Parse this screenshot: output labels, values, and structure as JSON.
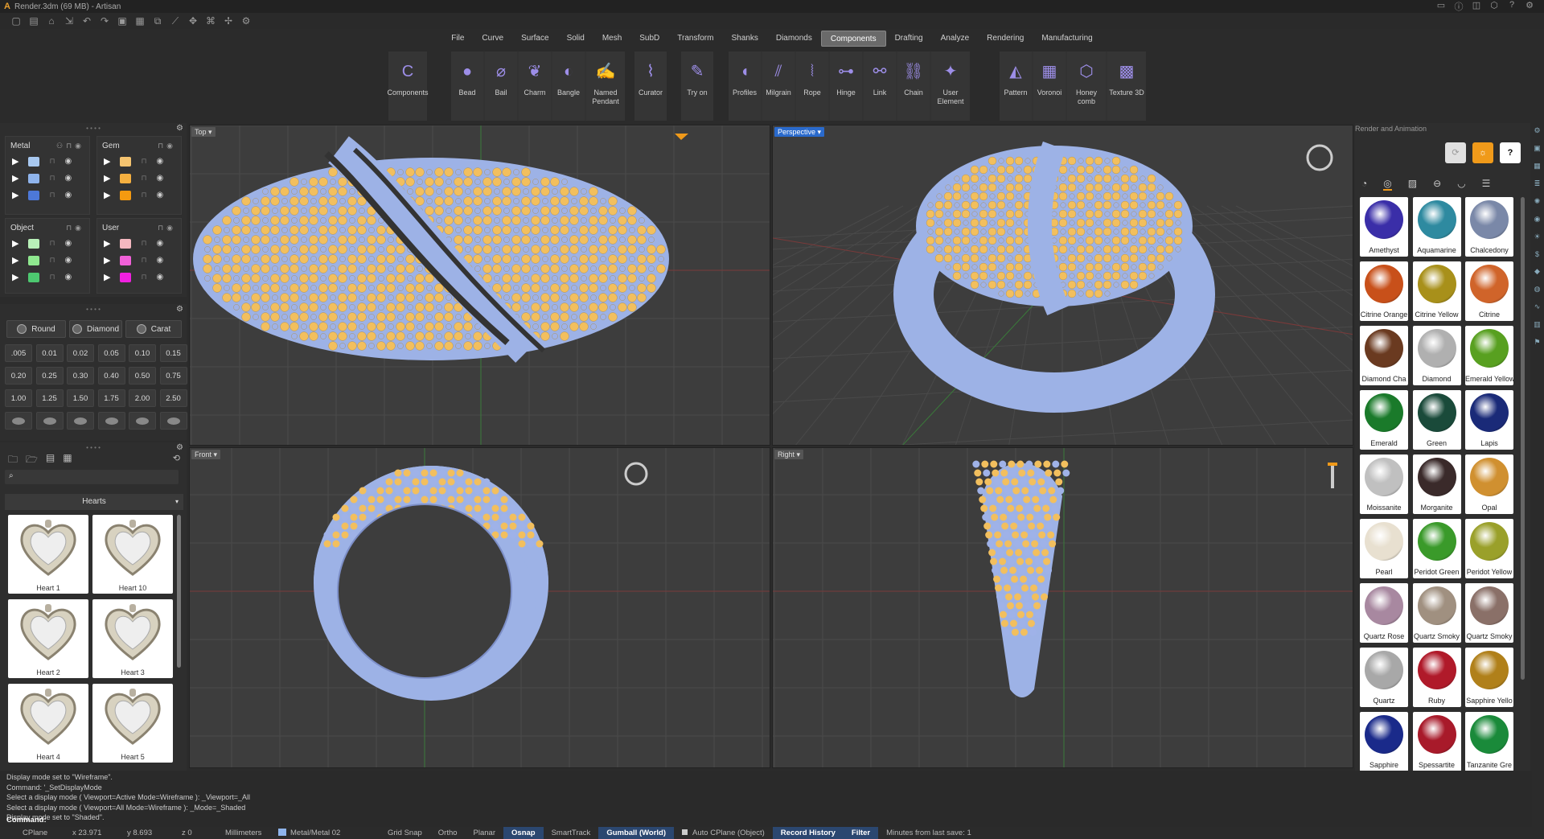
{
  "window": {
    "title": "Render.3dm (69 MB) - Artisan"
  },
  "menu": [
    {
      "label": "File"
    },
    {
      "label": "Curve"
    },
    {
      "label": "Surface"
    },
    {
      "label": "Solid"
    },
    {
      "label": "Mesh"
    },
    {
      "label": "SubD"
    },
    {
      "label": "Transform"
    },
    {
      "label": "Shanks"
    },
    {
      "label": "Diamonds"
    },
    {
      "label": "Components",
      "active": true
    },
    {
      "label": "Drafting"
    },
    {
      "label": "Analyze"
    },
    {
      "label": "Rendering"
    },
    {
      "label": "Manufacturing"
    }
  ],
  "ribbon": {
    "g1": [
      {
        "label": "Components",
        "icon": "C"
      }
    ],
    "g2": [
      {
        "label": "Bead",
        "icon": "●"
      },
      {
        "label": "Bail",
        "icon": "⌀"
      },
      {
        "label": "Charm",
        "icon": "❦"
      },
      {
        "label": "Bangle",
        "icon": "◐"
      },
      {
        "label": "Named Pendant",
        "icon": "✍"
      }
    ],
    "g3": [
      {
        "label": "Curator",
        "icon": "⌇"
      }
    ],
    "g4": [
      {
        "label": "Try on",
        "icon": "✎"
      }
    ],
    "g5": [
      {
        "label": "Profiles",
        "icon": "◖"
      },
      {
        "label": "Milgrain",
        "icon": "⫽"
      },
      {
        "label": "Rope",
        "icon": "⦚"
      },
      {
        "label": "Hinge",
        "icon": "⊶"
      },
      {
        "label": "Link",
        "icon": "⚯"
      },
      {
        "label": "Chain",
        "icon": "⛓"
      },
      {
        "label": "User Element",
        "icon": "✦"
      }
    ],
    "g6": [
      {
        "label": "Pattern",
        "icon": "◭"
      },
      {
        "label": "Voronoi",
        "icon": "▦"
      },
      {
        "label": "Honey comb",
        "icon": "⬡"
      },
      {
        "label": "Texture 3D",
        "icon": "▩"
      }
    ]
  },
  "layers": {
    "metal": {
      "title": "Metal",
      "colors": [
        "#a8c8f0",
        "#8fb4ec",
        "#4d78d8"
      ]
    },
    "gem": {
      "title": "Gem",
      "colors": [
        "#f5c470",
        "#f5b040",
        "#f59a10"
      ]
    },
    "object": {
      "title": "Object",
      "colors": [
        "#b8f0b8",
        "#8fe88f",
        "#4dc870"
      ]
    },
    "user": {
      "title": "User",
      "colors": [
        "#f5b8c0",
        "#f060d8",
        "#f020e0"
      ]
    }
  },
  "gems": {
    "types": [
      {
        "label": "Round"
      },
      {
        "label": "Diamond"
      },
      {
        "label": "Carat"
      }
    ],
    "sizes": [
      ".005",
      "0.01",
      "0.02",
      "0.05",
      "0.10",
      "0.15",
      "0.20",
      "0.25",
      "0.30",
      "0.40",
      "0.50",
      "0.75",
      "1.00",
      "1.25",
      "1.50",
      "1.75",
      "2.00",
      "2.50"
    ]
  },
  "library": {
    "category": "Hearts",
    "items": [
      {
        "label": "Heart 1"
      },
      {
        "label": "Heart 10"
      },
      {
        "label": "Heart 2"
      },
      {
        "label": "Heart 3"
      },
      {
        "label": "Heart 4"
      },
      {
        "label": "Heart 5"
      }
    ]
  },
  "viewports": {
    "top": "Top",
    "perspective": "Perspective",
    "front": "Front",
    "right": "Right"
  },
  "render_panel": {
    "title": "Render and Animation",
    "materials": [
      {
        "label": "Amethyst",
        "color": "#3a2ea8"
      },
      {
        "label": "Aquamarine",
        "color": "#2e8aa0"
      },
      {
        "label": "Chalcedony",
        "color": "#7a88a8"
      },
      {
        "label": "Citrine Orange",
        "color": "#c8501a"
      },
      {
        "label": "Citrine Yellow",
        "color": "#a8901a"
      },
      {
        "label": "Citrine",
        "color": "#d0642a"
      },
      {
        "label": "Diamond Cha",
        "color": "#6a3a20"
      },
      {
        "label": "Diamond",
        "color": "#b0b0b0"
      },
      {
        "label": "Emerald Yellow",
        "color": "#58a020"
      },
      {
        "label": "Emerald",
        "color": "#1a7a2a"
      },
      {
        "label": "Green",
        "color": "#1a4a3a"
      },
      {
        "label": "Lapis",
        "color": "#1a2a78"
      },
      {
        "label": "Moissanite",
        "color": "#c0c0c0"
      },
      {
        "label": "Morganite",
        "color": "#3a2a2a"
      },
      {
        "label": "Opal",
        "color": "#d09030"
      },
      {
        "label": "Pearl",
        "color": "#e8e0d0"
      },
      {
        "label": "Peridot Green",
        "color": "#3a9a2a"
      },
      {
        "label": "Peridot Yellow",
        "color": "#9aa02a"
      },
      {
        "label": "Quartz Rose",
        "color": "#a888a0"
      },
      {
        "label": "Quartz Smoky",
        "color": "#a09080"
      },
      {
        "label": "Quartz Smoky",
        "color": "#8a7068"
      },
      {
        "label": "Quartz",
        "color": "#a8a8a8"
      },
      {
        "label": "Ruby",
        "color": "#b01a2a"
      },
      {
        "label": "Sapphire Yello",
        "color": "#b0801a"
      },
      {
        "label": "Sapphire",
        "color": "#1a2a8a"
      },
      {
        "label": "Spessartite",
        "color": "#a81a2a"
      },
      {
        "label": "Tanzanite Gre",
        "color": "#1a8a3a"
      }
    ]
  },
  "command": {
    "history": [
      "Display mode set to \"Wireframe\".",
      "Command: '_SetDisplayMode",
      "Select a display mode ( Viewport=Active  Mode=Wireframe ): _Viewport=_All",
      "Select a display mode ( Viewport=All  Mode=Wireframe ): _Mode=_Shaded",
      "Display mode set to \"Shaded\"."
    ],
    "prompt": "Command:"
  },
  "status": {
    "cplane": "CPlane",
    "x": "x 23.971",
    "y": "y 8.693",
    "z": "z 0",
    "units": "Millimeters",
    "layer": "Metal/Metal 02",
    "items": [
      {
        "label": "Grid Snap",
        "on": false
      },
      {
        "label": "Ortho",
        "on": false
      },
      {
        "label": "Planar",
        "on": false
      },
      {
        "label": "Osnap",
        "on": true
      },
      {
        "label": "SmartTrack",
        "on": false
      },
      {
        "label": "Gumball (World)",
        "on": true
      },
      {
        "label": "Auto CPlane (Object)",
        "on": false
      },
      {
        "label": "Record History",
        "on": true
      },
      {
        "label": "Filter",
        "on": true
      }
    ],
    "save": "Minutes from last save: 1"
  }
}
